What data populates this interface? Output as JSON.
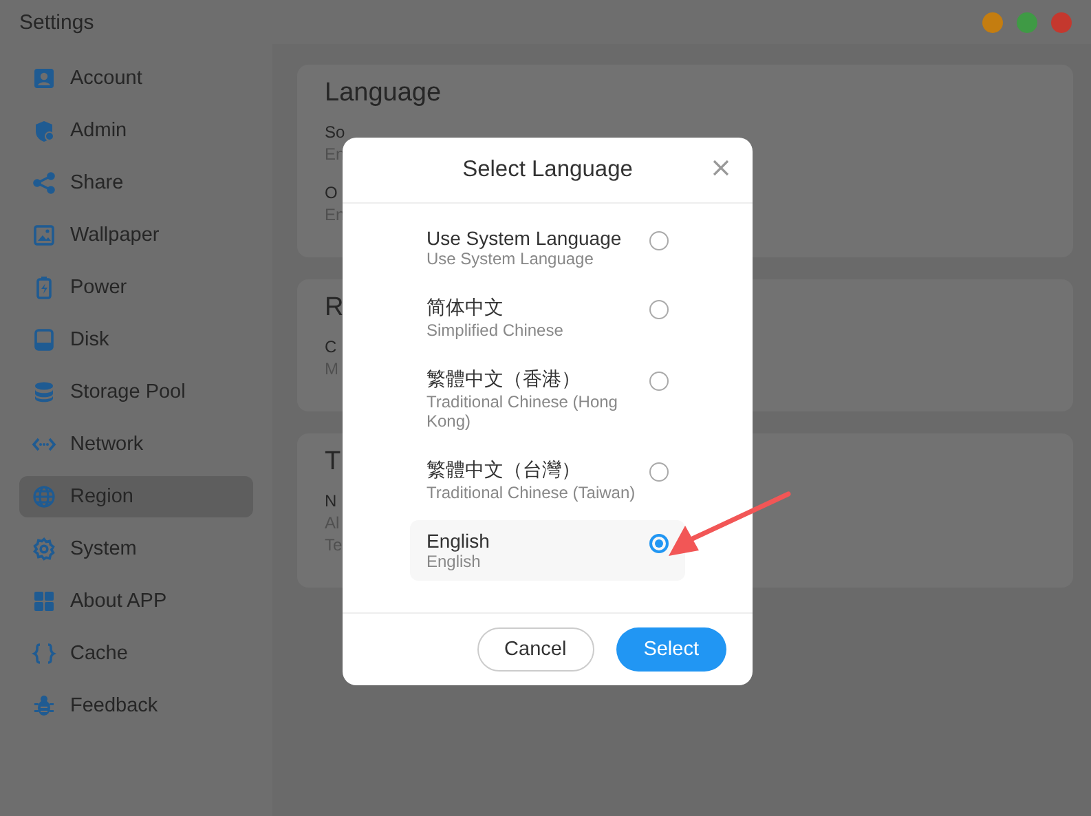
{
  "window": {
    "title": "Settings",
    "controls": [
      {
        "color": "#c47d10"
      },
      {
        "color": "#3f9a45"
      },
      {
        "color": "#c4382e"
      }
    ]
  },
  "sidebar": {
    "items": [
      {
        "label": "Account",
        "selected": false
      },
      {
        "label": "Admin",
        "selected": false
      },
      {
        "label": "Share",
        "selected": false
      },
      {
        "label": "Wallpaper",
        "selected": false
      },
      {
        "label": "Power",
        "selected": false
      },
      {
        "label": "Disk",
        "selected": false
      },
      {
        "label": "Storage Pool",
        "selected": false
      },
      {
        "label": "Network",
        "selected": false
      },
      {
        "label": "Region",
        "selected": true
      },
      {
        "label": "System",
        "selected": false
      },
      {
        "label": "About APP",
        "selected": false
      },
      {
        "label": "Cache",
        "selected": false
      },
      {
        "label": "Feedback",
        "selected": false
      }
    ]
  },
  "sections": [
    {
      "title": "Language",
      "rows": [
        {
          "label": "So",
          "lines": [
            "En"
          ]
        },
        {
          "label": "O",
          "lines": [
            "En"
          ]
        }
      ]
    },
    {
      "title": "R",
      "rows": [
        {
          "label": "C",
          "lines": [
            "M"
          ]
        }
      ]
    },
    {
      "title": "T",
      "rows": [
        {
          "label": "N",
          "lines": [
            "Al",
            "Te"
          ]
        }
      ]
    }
  ],
  "dialog": {
    "title": "Select Language",
    "options": [
      {
        "name": "Use System Language",
        "subtitle": "Use System Language",
        "selected": false
      },
      {
        "name": "简体中文",
        "subtitle": "Simplified Chinese",
        "selected": false
      },
      {
        "name": "繁體中文（香港）",
        "subtitle": "Traditional Chinese (Hong Kong)",
        "selected": false
      },
      {
        "name": "繁體中文（台灣）",
        "subtitle": "Traditional Chinese (Taiwan)",
        "selected": false
      },
      {
        "name": "English",
        "subtitle": "English",
        "selected": true
      }
    ],
    "buttons": [
      {
        "label": "Cancel",
        "kind": "secondary"
      },
      {
        "label": "Select",
        "kind": "primary"
      }
    ]
  }
}
